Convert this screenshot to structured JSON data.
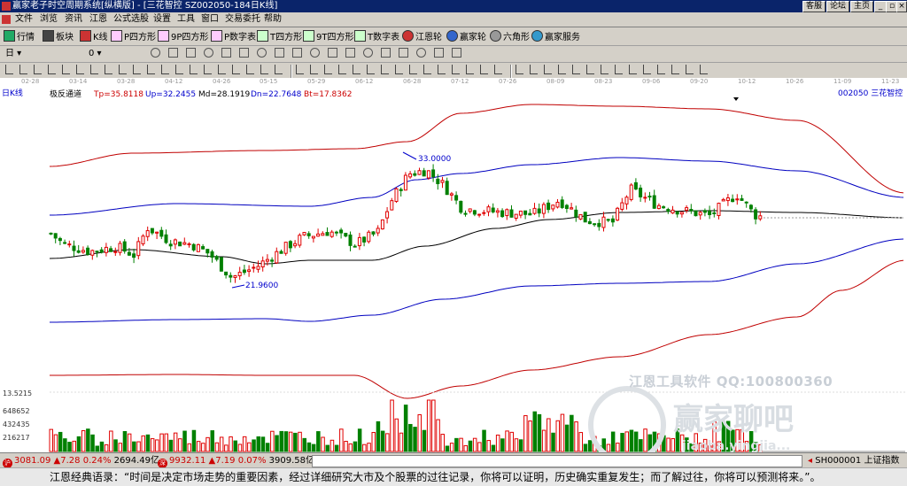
{
  "window": {
    "title": "赢家老子时空周期系统[纵横版] - [三花智控  SZ002050-184日K线]",
    "right_buttons": [
      "客服",
      "论坛",
      "主页"
    ]
  },
  "menu": [
    "文件",
    "浏览",
    "资讯",
    "江恩",
    "公式选股",
    "设置",
    "工具",
    "窗口",
    "交易委托",
    "帮助"
  ],
  "toolbar1": [
    "行情",
    "板块",
    "K线",
    "P四方形",
    "9P四方形",
    "P数字表",
    "T四方形",
    "9T四方形",
    "T数字表",
    "江恩轮",
    "赢家轮",
    "六角形",
    "赢家服务"
  ],
  "toolbar2": [
    "日",
    "0"
  ],
  "dates": [
    "02-28",
    "03-14",
    "03-28",
    "04-12",
    "04-26",
    "05-15",
    "05-29",
    "06-12",
    "06-28",
    "07-12",
    "07-26",
    "08-09",
    "08-23",
    "09-06",
    "09-20",
    "10-12",
    "10-26",
    "11-09",
    "11-23"
  ],
  "indicator": {
    "period_label": "日K线",
    "name": "极反通道",
    "tp": "Tp=35.8118",
    "up": "Up=32.2455",
    "md": "Md=28.1919",
    "dn": "Dn=22.7648",
    "bt": "Bt=17.8362",
    "stock": "002050  三花智控"
  },
  "annotations": {
    "high": "33.0000",
    "low": "21.9600"
  },
  "volume": {
    "max": "13.5215",
    "labels": [
      "648652",
      "432435",
      "216217"
    ]
  },
  "watermark": {
    "line1": "江恩工具软件  QQ:100800360",
    "brand": "赢家聊吧",
    "url": "jiaoba.yingjia..."
  },
  "status": {
    "sh_badge": "沪",
    "sh_index": "3081.09",
    "sh_change": "▲7.28",
    "sh_pct": "0.24%",
    "sh_amount": "2694.49亿",
    "sz_badge": "深",
    "sz_index": "9932.11",
    "sz_change": "▲7.19",
    "sz_pct": "0.07%",
    "sz_amount": "3909.58亿",
    "code": "SH000001",
    "code_name": "上证指数"
  },
  "quote": "江恩经典语录：“时间是决定市场走势的重要因素，经过详细研究大市及个股票的过往记录，你将可以证明，历史确实重复发生；而了解过往，你将可以预测将来。”。",
  "colors": {
    "red": "#e00000",
    "green": "#008000",
    "blue": "#0000c0",
    "upper_band": "#c00000"
  }
}
